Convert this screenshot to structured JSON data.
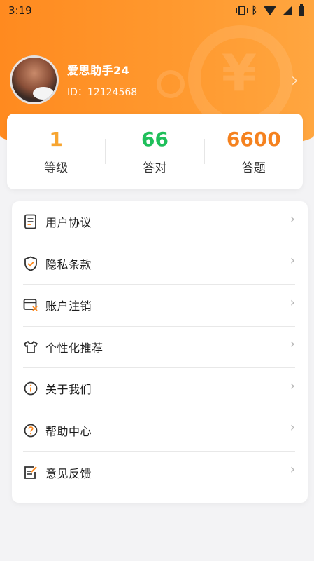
{
  "status_bar": {
    "time": "3:19"
  },
  "profile": {
    "name": "爱思助手24",
    "id_text": "ID：12124568"
  },
  "stats": [
    {
      "value": "1",
      "label": "等级",
      "color": "#f7a530"
    },
    {
      "value": "66",
      "label": "答对",
      "color": "#1fbf5a"
    },
    {
      "value": "6600",
      "label": "答题",
      "color": "#f5821f"
    }
  ],
  "menu": {
    "items": [
      {
        "label": "用户协议",
        "icon": "document-icon"
      },
      {
        "label": "隐私条款",
        "icon": "shield-check-icon"
      },
      {
        "label": "账户注销",
        "icon": "account-cancel-icon"
      },
      {
        "label": "个性化推荐",
        "icon": "tshirt-icon"
      },
      {
        "label": "关于我们",
        "icon": "info-icon"
      },
      {
        "label": "帮助中心",
        "icon": "help-icon"
      },
      {
        "label": "意见反馈",
        "icon": "feedback-edit-icon"
      }
    ]
  },
  "colors": {
    "header": "#ff8a1f",
    "accent": "#ff8a1f"
  }
}
